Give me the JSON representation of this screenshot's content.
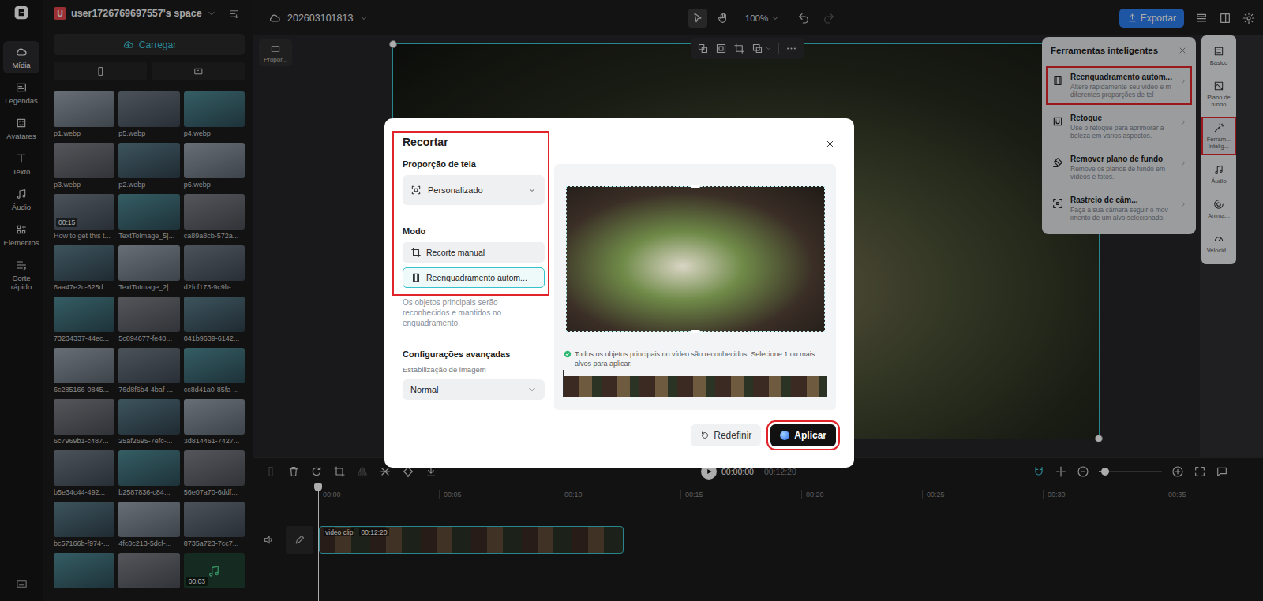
{
  "rail": {
    "items": [
      {
        "label": "Mídia",
        "selected": true
      },
      {
        "label": "Legendas",
        "selected": false
      },
      {
        "label": "Avatares",
        "selected": false
      },
      {
        "label": "Texto",
        "selected": false
      },
      {
        "label": "Áudio",
        "selected": false
      },
      {
        "label": "Elementos",
        "selected": false
      },
      {
        "label": "Corte rápido",
        "selected": false
      }
    ]
  },
  "media": {
    "avatar": "U",
    "space": "user1726769697557's space",
    "upload": "Carregar",
    "thumbs": [
      {
        "label": "p1.webp",
        "kind": "image"
      },
      {
        "label": "p5.webp",
        "kind": "image"
      },
      {
        "label": "p4.webp",
        "kind": "image"
      },
      {
        "label": "p3.webp",
        "kind": "image"
      },
      {
        "label": "p2.webp",
        "kind": "image"
      },
      {
        "label": "p6.webp",
        "kind": "image"
      },
      {
        "label": "How to get this t...",
        "kind": "video",
        "duration": "00:15"
      },
      {
        "label": "TextToImage_5|...",
        "kind": "image"
      },
      {
        "label": "ca89a8cb-572a...",
        "kind": "image"
      },
      {
        "label": "6aa47e2c-625d...",
        "kind": "image"
      },
      {
        "label": "TextToImage_2|...",
        "kind": "image"
      },
      {
        "label": "d2fcf173-9c9b-...",
        "kind": "image"
      },
      {
        "label": "73234337-44ec...",
        "kind": "image"
      },
      {
        "label": "5c894677-fe48...",
        "kind": "image"
      },
      {
        "label": "041b9639-6142...",
        "kind": "image"
      },
      {
        "label": "6c285166-0845...",
        "kind": "image"
      },
      {
        "label": "76d8f6b4-4baf-...",
        "kind": "image"
      },
      {
        "label": "cc8d41a0-85fa-...",
        "kind": "image"
      },
      {
        "label": "6c7969b1-c487...",
        "kind": "image"
      },
      {
        "label": "25af2695-7efc-...",
        "kind": "image"
      },
      {
        "label": "3d814461-7427...",
        "kind": "image"
      },
      {
        "label": "b5e34c44-492...",
        "kind": "image"
      },
      {
        "label": "b2587836-c84...",
        "kind": "image"
      },
      {
        "label": "56e07a70-6ddf...",
        "kind": "image"
      },
      {
        "label": "bc57166b-f974-...",
        "kind": "image"
      },
      {
        "label": "4fc0c213-5dcf-...",
        "kind": "image"
      },
      {
        "label": "8735a723-7cc7...",
        "kind": "image"
      },
      {
        "kind": "image"
      },
      {
        "kind": "image"
      },
      {
        "kind": "audio",
        "duration": "00:03"
      }
    ]
  },
  "topbar": {
    "project": "202603101813",
    "tools": [
      {
        "selected": true
      },
      {
        "selected": false
      }
    ],
    "zoom": "100%",
    "redo_disabled": true,
    "export": "Exportar"
  },
  "canvas": {
    "ratio_button": "Propor..."
  },
  "right_rail": {
    "items": [
      {
        "label": "Básico",
        "selected": false,
        "highlighted": false
      },
      {
        "label": "Plano de fundo",
        "selected": false,
        "highlighted": false
      },
      {
        "label": "Ferram... intelig...",
        "selected": true,
        "highlighted": true
      },
      {
        "label": "Áudio",
        "selected": false,
        "highlighted": false
      },
      {
        "label": "Anima...",
        "selected": false,
        "highlighted": false
      },
      {
        "label": "Velocid...",
        "selected": false,
        "highlighted": false
      }
    ]
  },
  "smart_tools": {
    "title": "Ferramentas inteligentes",
    "items": [
      {
        "title": "Reenquadramento autom...",
        "description": "Altere rapidamente seu vídeo e m diferentes proporções de tel",
        "highlighted": true
      },
      {
        "title": "Retoque",
        "description": "Use o retoque para aprimorar a beleza em vários aspectos.",
        "highlighted": false
      },
      {
        "title": "Remover plano de fundo",
        "description": "Remove os planos de fundo em vídeos e fotos.",
        "highlighted": false
      },
      {
        "title": "Rastreio de câm...",
        "description": "Faça a sua câmera seguir o mov imento de um alvo selecionado.",
        "highlighted": false
      }
    ]
  },
  "modal": {
    "title": "Recortar",
    "ratio_label": "Proporção de tela",
    "ratio_value": "Personalizado",
    "mode_label": "Modo",
    "modes": [
      {
        "label": "Recorte manual",
        "selected": false
      },
      {
        "label": "Reenquadramento autom...",
        "selected": true
      }
    ],
    "mode_description": "Os objetos principais serão reconhecidos e mantidos no enquadramento.",
    "advanced_title": "Configurações avançadas",
    "stabilization_label": "Estabilização de imagem",
    "stabilization_value": "Normal",
    "info": "Todos os objetos principais no vídeo são reconhecidos. Selecione 1 ou mais alvos para aplicar.",
    "reset": "Redefinir",
    "apply": "Aplicar",
    "panel_highlighted": true,
    "apply_highlighted": true
  },
  "timeline": {
    "tools": [
      {
        "disabled": true
      },
      {
        "disabled": false
      },
      {
        "disabled": false
      },
      {
        "disabled": false
      },
      {
        "disabled": true
      },
      {
        "disabled": false
      },
      {
        "disabled": false
      },
      {
        "disabled": false
      }
    ],
    "current": "00:00:00",
    "total": "00:12:20",
    "ruler": [
      "00:00",
      "00:05",
      "00:10",
      "00:15",
      "00:20",
      "00:25",
      "00:30",
      "00:35"
    ],
    "clip": {
      "label": "video clip",
      "duration": "00:12:20"
    },
    "zoom_level": 0.1
  }
}
